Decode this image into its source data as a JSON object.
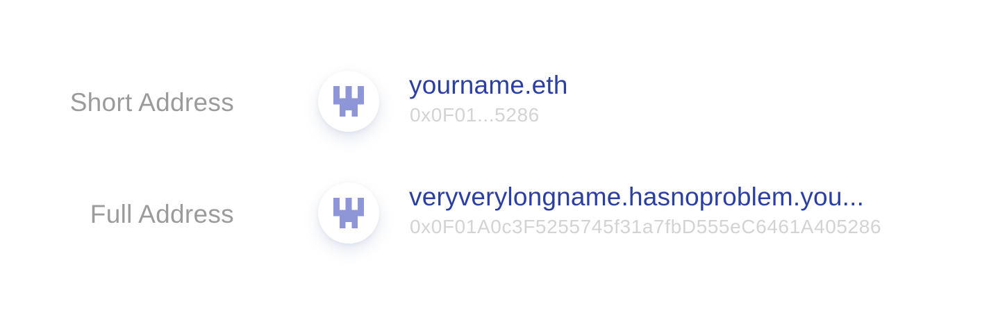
{
  "accent_color": "#2b3fa1",
  "avatar_color": "#8f96d8",
  "rows": {
    "short": {
      "label": "Short Address",
      "avatar_icon": "identicon-avatar",
      "name": "yourname.eth",
      "address": "0x0F01...5286"
    },
    "full": {
      "label": "Full Address",
      "avatar_icon": "identicon-avatar",
      "name": "veryverylongname.hasnoproblem.you...",
      "address": "0x0F01A0c3F5255745f31a7fbD555eC6461A405286"
    }
  }
}
